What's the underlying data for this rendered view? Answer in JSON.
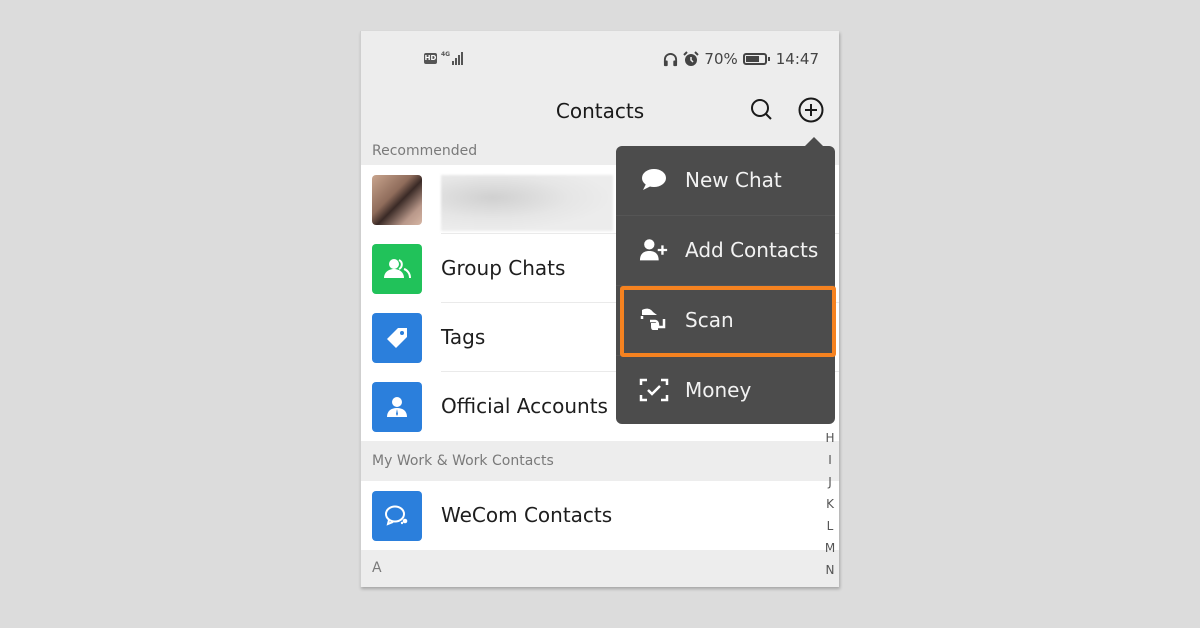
{
  "status_bar": {
    "left_icons": [
      "hd-icon",
      "signal-4g-icon"
    ],
    "network_label": "4G",
    "hd_label": "HD",
    "right_icons": [
      "headphones-icon",
      "alarm-icon",
      "battery-icon"
    ],
    "battery_percent": "70%",
    "battery_level": 0.7,
    "time": "14:47"
  },
  "header": {
    "title": "Contacts",
    "search_icon": "search-icon",
    "add_icon": "plus-circle-icon"
  },
  "sections": {
    "recommended": "Recommended",
    "work": "My Work & Work Contacts",
    "letter_a": "A"
  },
  "rows": [
    {
      "label": "",
      "icon": "avatar",
      "blurred": true
    },
    {
      "label": "Group Chats",
      "icon": "group-icon",
      "color": "#21c25a"
    },
    {
      "label": "Tags",
      "icon": "tag-icon",
      "color": "#2b7fdc"
    },
    {
      "label": "Official Accounts",
      "icon": "official-account-icon",
      "color": "#2b7fdc"
    },
    {
      "label": "WeCom Contacts",
      "icon": "wecom-icon",
      "color": "#2b7fdc"
    }
  ],
  "alphabet_index": [
    "H",
    "I",
    "J",
    "K",
    "L",
    "M",
    "N"
  ],
  "popup_menu": {
    "items": [
      {
        "label": "New Chat",
        "icon": "chat-bubble-icon"
      },
      {
        "label": "Add Contacts",
        "icon": "add-contact-icon"
      },
      {
        "label": "Scan",
        "icon": "scan-icon",
        "highlighted": true
      },
      {
        "label": "Money",
        "icon": "money-scan-icon"
      }
    ],
    "highlight_color": "#f58220"
  }
}
